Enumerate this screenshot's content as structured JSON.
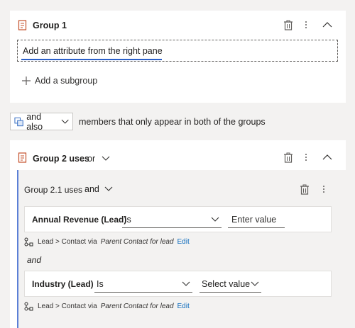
{
  "group1": {
    "title": "Group 1",
    "attribute_placeholder": "Add an attribute from the right pane",
    "add_subgroup": "Add a subgroup"
  },
  "combine": {
    "operator": "and also",
    "description": "members that only appear in both of the groups"
  },
  "group2": {
    "title": "Group 2 uses",
    "operator": "or",
    "subgroup": {
      "title": "Group 2.1 uses",
      "operator": "and",
      "conditions": [
        {
          "attribute": "Annual Revenue (Lead)",
          "comparison": "Is",
          "value_placeholder": "Enter value",
          "path_prefix": "Lead > Contact via",
          "path_relationship": "Parent Contact for lead",
          "edit_label": "Edit"
        },
        {
          "attribute": "Industry (Lead)",
          "comparison": "Is",
          "value_placeholder": "Select value",
          "path_prefix": "Lead > Contact via",
          "path_relationship": "Parent Contact for lead",
          "edit_label": "Edit"
        }
      ],
      "conjunction": "and"
    }
  },
  "icons": [
    "document-icon",
    "trash-icon",
    "more-icon",
    "chevron-up-icon",
    "chevron-down-icon",
    "plus-icon",
    "merge-icon",
    "relationship-icon"
  ],
  "colors": {
    "accent": "#2b60c9",
    "link": "#0f6cbd",
    "doc_icon": "#c4512b",
    "merge_icon": "#3c72c4",
    "subgroup_border": "#5b7fd6"
  }
}
